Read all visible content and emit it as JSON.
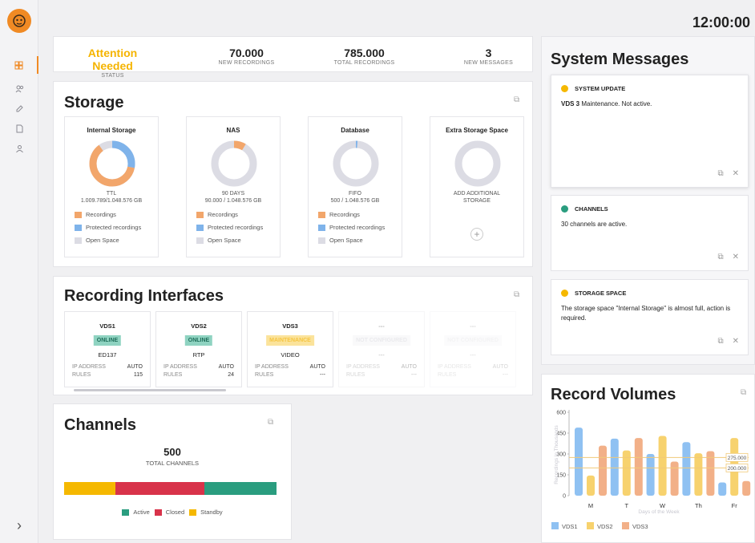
{
  "clock": "12:00:00",
  "summary": {
    "status_value": "Attention Needed",
    "status_label": "STATUS",
    "new_rec_value": "70.000",
    "new_rec_label": "NEW RECORDINGS",
    "total_rec_value": "785.000",
    "total_rec_label": "TOTAL RECORDINGS",
    "messages_value": "3",
    "messages_label": "NEW MESSAGES"
  },
  "storage": {
    "title": "Storage",
    "legend": {
      "recordings": "Recordings",
      "protected": "Protected recordings",
      "open": "Open Space"
    },
    "cards": [
      {
        "title": "Internal Storage",
        "sub1": "TTL",
        "sub2": "1.009.789/1.048.576 GB",
        "recordings": 0.62,
        "protected": 0.28
      },
      {
        "title": "NAS",
        "sub1": "90 DAYS",
        "sub2": "90.000 / 1.048.576 GB",
        "recordings": 0.086,
        "protected": 0.0
      },
      {
        "title": "Database",
        "sub1": "FIFO",
        "sub2": "500 / 1.048.576 GB",
        "recordings": 0.0,
        "protected": 0.012
      },
      {
        "title": "Extra Storage Space",
        "sub1": "ADD ADDITIONAL",
        "sub2": "STORAGE",
        "add": "+"
      }
    ],
    "colors": {
      "recordings": "#f2a66b",
      "protected": "#7fb3ea",
      "open": "#dcdce4"
    }
  },
  "interfaces": {
    "title": "Recording Interfaces",
    "ip_label": "IP ADDRESS",
    "rules_label": "RULES",
    "items": [
      {
        "name": "VDS1",
        "status": "ONLINE",
        "protocol": "ED137",
        "ip": "AUTO",
        "rules": "115"
      },
      {
        "name": "VDS2",
        "status": "ONLINE",
        "protocol": "RTP",
        "ip": "AUTO",
        "rules": "24"
      },
      {
        "name": "VDS3",
        "status": "MAINTENANCE",
        "protocol": "VIDEO",
        "ip": "AUTO",
        "rules": "---"
      },
      {
        "name": "---",
        "status": "NOT CONFIGURED",
        "protocol": "---",
        "ip": "AUTO",
        "rules": "---"
      },
      {
        "name": "---",
        "status": "NOT CONFIGURED",
        "protocol": "---",
        "ip": "AUTO",
        "rules": "---"
      }
    ]
  },
  "channels": {
    "title": "Channels",
    "total_value": "500",
    "total_label": "TOTAL CHANNELS",
    "bar": [
      {
        "name": "Standby",
        "fraction": 0.24,
        "color": "#f5b800"
      },
      {
        "name": "Closed",
        "fraction": 0.42,
        "color": "#d8334a"
      },
      {
        "name": "Active",
        "fraction": 0.34,
        "color": "#2a9d7f"
      }
    ],
    "legend": {
      "active": "Active",
      "closed": "Closed",
      "standby": "Standby"
    }
  },
  "messages": {
    "title": "System Messages",
    "items": [
      {
        "type": "SYSTEM UPDATE",
        "color": "#f5b800",
        "body_bold": "VDS 3",
        "body": " Maintenance. Not active."
      },
      {
        "type": "CHANNELS",
        "color": "#2a9d7f",
        "body_bold": "",
        "body": "30 channels are active."
      },
      {
        "type": "STORAGE SPACE",
        "color": "#f5b800",
        "body_bold": "",
        "body": "The storage space \"Internal Storage\" is almost full, action is required."
      }
    ]
  },
  "volumes": {
    "title": "Record Volumes",
    "chart_data": {
      "type": "bar",
      "categories": [
        "M",
        "T",
        "W",
        "Th",
        "Fr"
      ],
      "series": [
        {
          "name": "VDS1",
          "values": [
            490,
            410,
            300,
            385,
            95
          ],
          "color": "#8fc1f2"
        },
        {
          "name": "VDS2",
          "values": [
            145,
            325,
            430,
            305,
            415
          ],
          "color": "#f7d26e"
        },
        {
          "name": "VDS3",
          "values": [
            360,
            415,
            245,
            320,
            105
          ],
          "color": "#f2b088"
        }
      ],
      "ylim": [
        0,
        600
      ],
      "yticks": [
        "600",
        "450",
        "300",
        "150",
        "0"
      ],
      "xlabel": "Days of the Week",
      "ylabel": "Recordings in Thousands",
      "reference_lines": [
        {
          "label": "275.000",
          "value": 275
        },
        {
          "label": "200.000",
          "value": 200
        }
      ]
    }
  }
}
